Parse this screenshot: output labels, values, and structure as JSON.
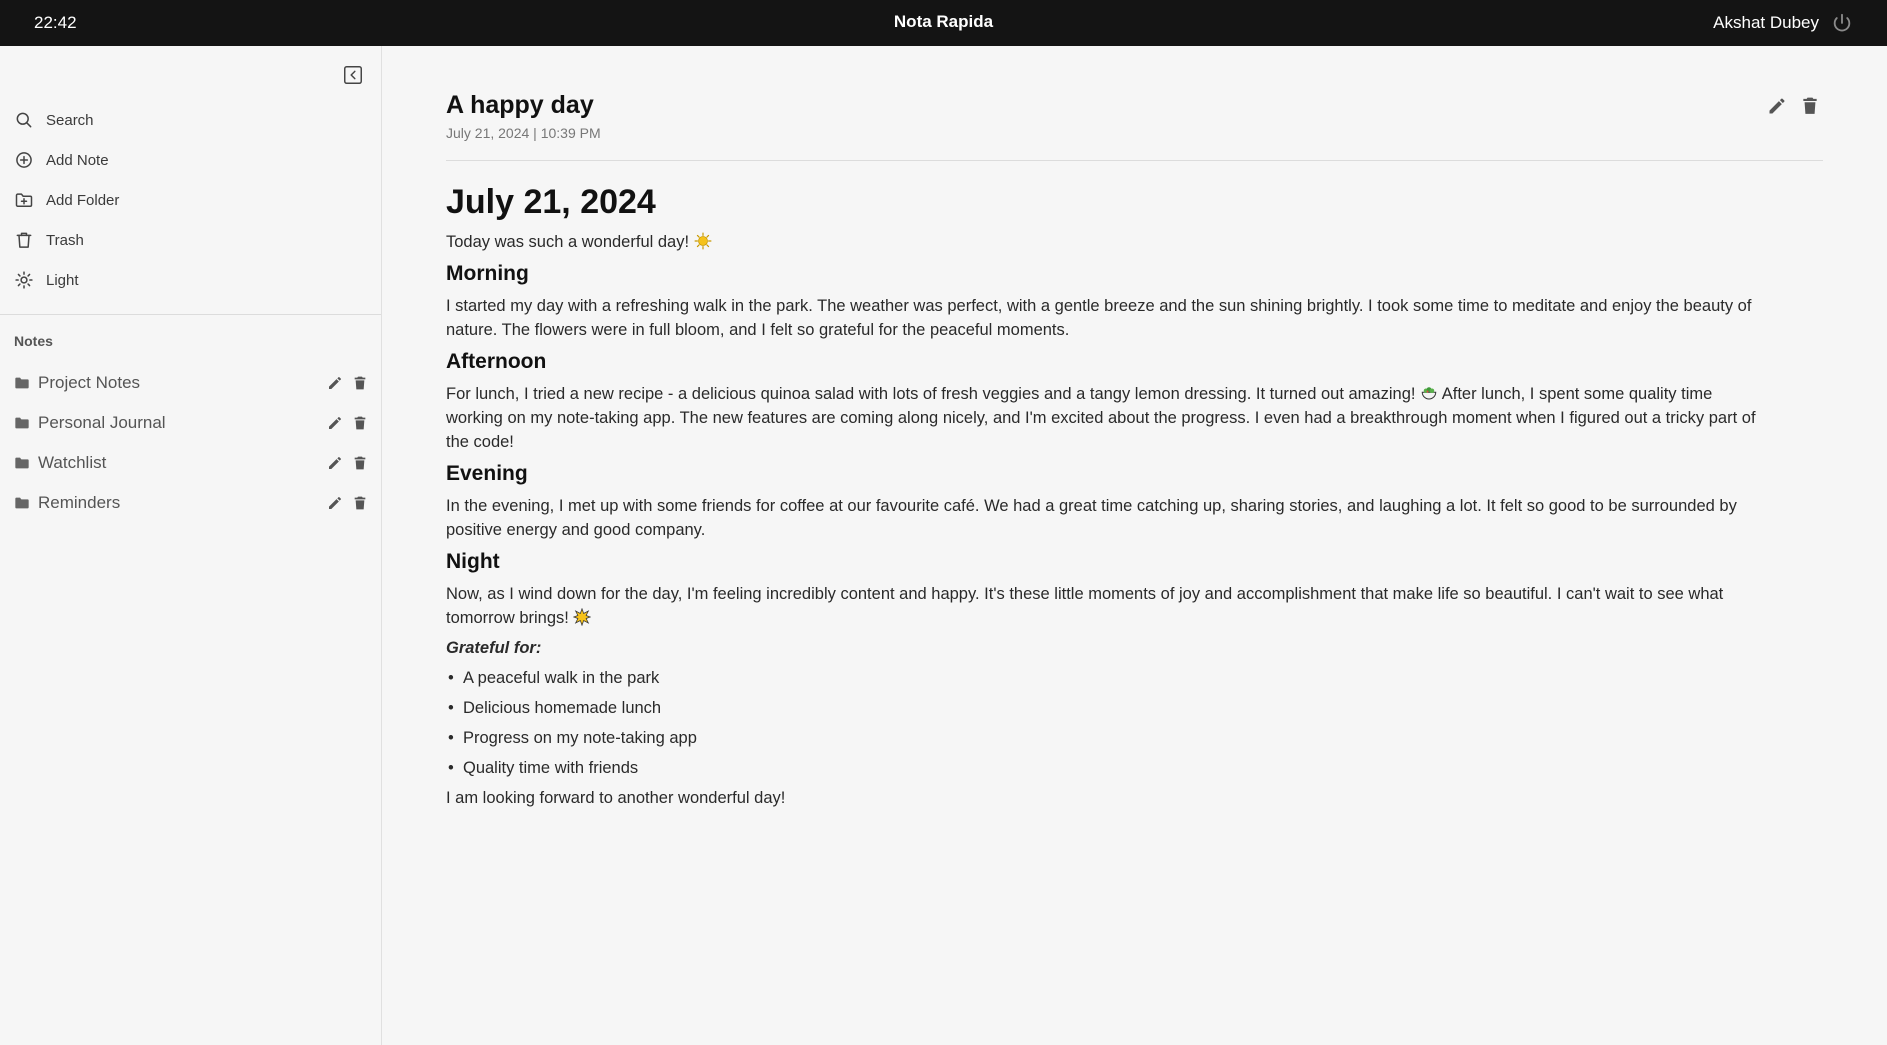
{
  "topbar": {
    "time": "22:42",
    "app_name": "Nota Rapida",
    "user_name": "Akshat Dubey"
  },
  "sidebar": {
    "menu": [
      {
        "label": "Search",
        "icon": "search-icon"
      },
      {
        "label": "Add Note",
        "icon": "plus-circle-icon"
      },
      {
        "label": "Add Folder",
        "icon": "folder-plus-icon"
      },
      {
        "label": "Trash",
        "icon": "trash-icon"
      },
      {
        "label": "Light",
        "icon": "sun-icon"
      }
    ],
    "notes_heading": "Notes",
    "folders": [
      {
        "name": "Project Notes"
      },
      {
        "name": "Personal Journal"
      },
      {
        "name": "Watchlist"
      },
      {
        "name": "Reminders"
      }
    ]
  },
  "note": {
    "title": "A happy day",
    "meta": "July 21, 2024 | 10:39 PM",
    "heading": "July 21, 2024",
    "intro": "Today was such a wonderful day!",
    "morning_heading": "Morning",
    "morning_text": "I started my day with a refreshing walk in the park. The weather was perfect, with a gentle breeze and the sun shining brightly. I took some time to meditate and enjoy the beauty of nature. The flowers were in full bloom, and I felt so grateful for the peaceful moments.",
    "afternoon_heading": "Afternoon",
    "afternoon_text_1": "For lunch, I tried a new recipe - a delicious quinoa salad with lots of fresh veggies and a tangy lemon dressing. It turned out amazing!",
    "afternoon_text_2": "After lunch, I spent some quality time working on my note-taking app. The new features are coming along nicely, and I'm excited about the progress. I even had a breakthrough moment when I figured out a tricky part of the code!",
    "evening_heading": "Evening",
    "evening_text": "In the evening, I met up with some friends for coffee at our favourite café. We had a great time catching up, sharing stories, and laughing a lot. It felt so good to be surrounded by positive energy and good company.",
    "night_heading": "Night",
    "night_text": "Now, as I wind down for the day, I'm feeling incredibly content and happy. It's these little moments of joy and accomplishment that make life so beautiful. I can't wait to see what tomorrow brings!",
    "grateful_label": "Grateful for:",
    "grateful_items": [
      "A peaceful walk in the park",
      "Delicious homemade lunch",
      "Progress on my note-taking app",
      "Quality time with friends"
    ],
    "closing": "I am looking forward to another wonderful day!"
  }
}
